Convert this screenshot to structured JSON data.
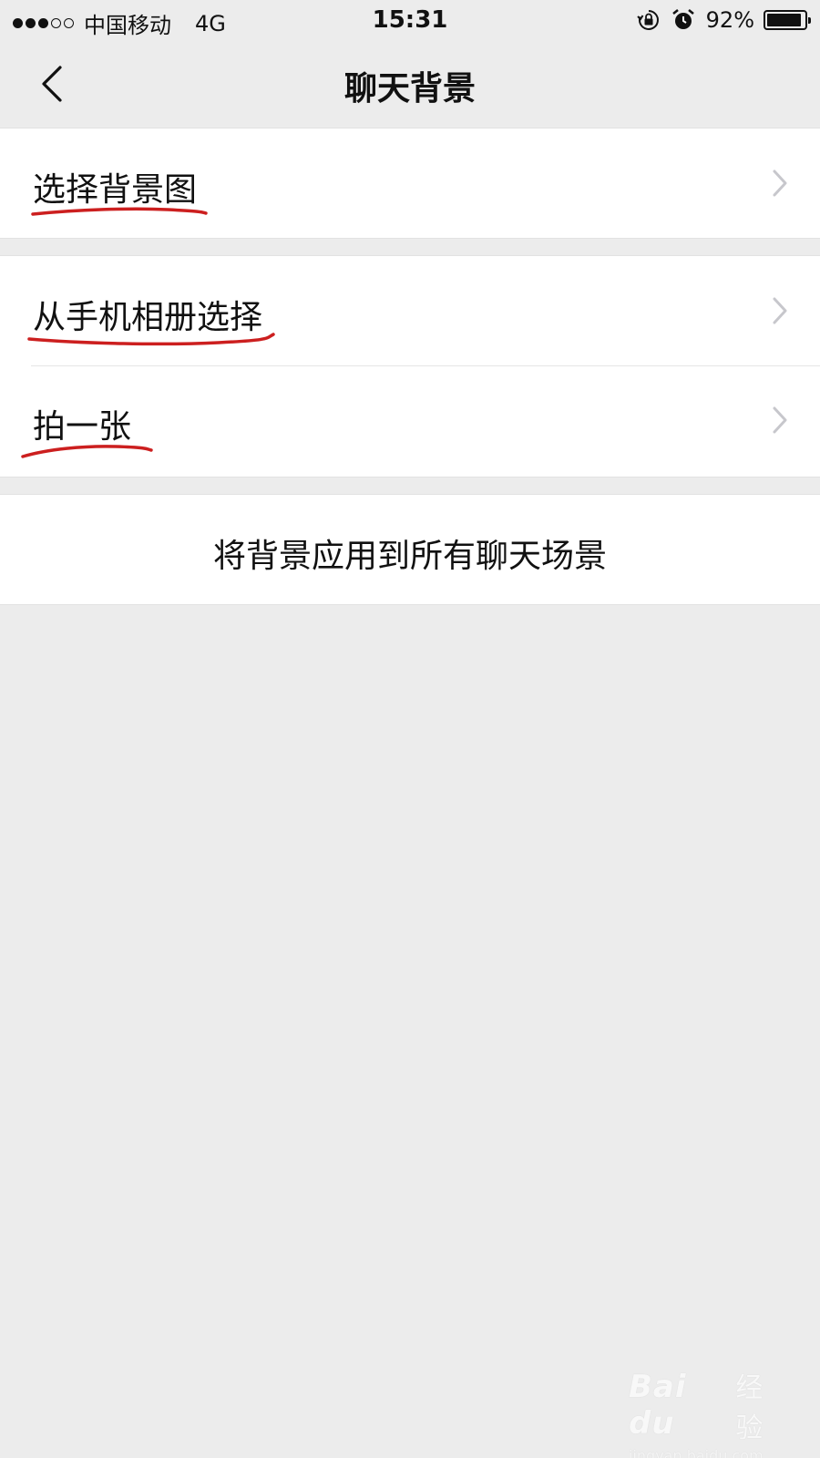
{
  "status_bar": {
    "signal_dots_filled": 3,
    "signal_dots_total": 5,
    "carrier": "中国移动",
    "network": "4G",
    "time": "15:31",
    "icons": [
      "rotation-lock-icon",
      "alarm-icon"
    ],
    "battery_percent": "92%",
    "battery_level": 0.92
  },
  "nav": {
    "back_icon": "chevron-left-icon",
    "title": "聊天背景"
  },
  "groups": [
    {
      "items": [
        {
          "label": "选择背景图",
          "icon": "chevron-right-icon"
        }
      ]
    },
    {
      "items": [
        {
          "label": "从手机相册选择",
          "icon": "chevron-right-icon"
        },
        {
          "label": "拍一张",
          "icon": "chevron-right-icon"
        }
      ]
    }
  ],
  "apply_all": {
    "label": "将背景应用到所有聊天场景"
  },
  "annotation": {
    "underline_color": "#cc1f1f"
  },
  "watermark": {
    "logo": "Bai du",
    "cn": "经验",
    "url": "jingyan.baidu.com"
  },
  "colors": {
    "background": "#ececec",
    "cell": "#ffffff",
    "chevron": "#c7c7cc",
    "text": "#111111"
  }
}
